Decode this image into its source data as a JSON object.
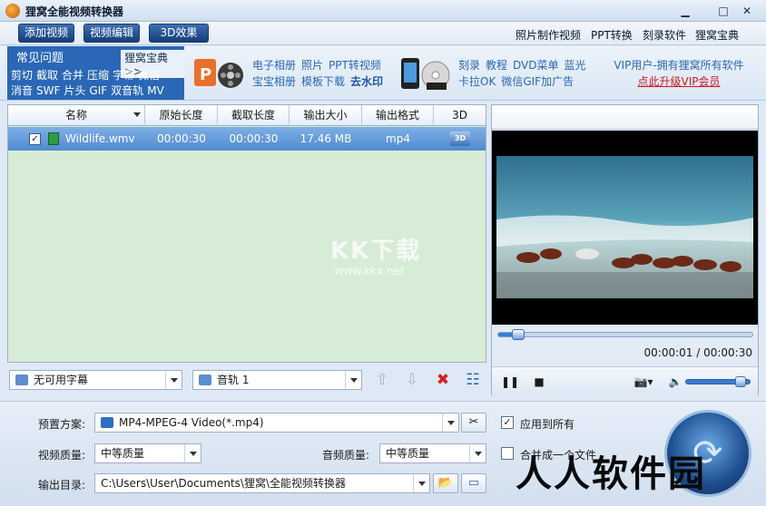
{
  "titlebar": {
    "title": "狸窝全能视频转换器",
    "minimize": "▁",
    "maximize": "□",
    "close": "✕"
  },
  "menubar": {
    "buttons": [
      "添加视频",
      "视频编辑",
      "3D效果"
    ],
    "links": [
      "照片制作视频",
      "PPT转换",
      "刻录软件",
      "狸窝宝典"
    ]
  },
  "banner": {
    "faq_title": "常见问题",
    "faq_more": "狸窝宝典>>",
    "faq_row1": [
      "剪切",
      "截取",
      "合并",
      "压缩",
      "字幕",
      "微信"
    ],
    "faq_row2": [
      "消音",
      "SWF",
      "片头",
      "GIF",
      "双音轨",
      "MV"
    ],
    "mid_row1": [
      "电子相册",
      "照片",
      "PPT转视频"
    ],
    "mid_row2": [
      "宝宝相册",
      "模板下载"
    ],
    "mid_bold": "去水印",
    "right_row1": [
      "刻录",
      "教程",
      "DVD菜单",
      "蓝光"
    ],
    "right_row2": [
      "卡拉OK",
      "微信GIF加广告"
    ],
    "vip_text": "VIP用户-拥有狸窝所有软件",
    "vip_upgrade": "点此升级VIP会员"
  },
  "file_list": {
    "columns": [
      "名称",
      "原始长度",
      "截取长度",
      "输出大小",
      "输出格式",
      "3D"
    ],
    "rows": [
      {
        "name": "Wildlife.wmv",
        "original_length": "00:00:30",
        "clip_length": "00:00:30",
        "output_size": "17.46 MB",
        "output_format": "mp4",
        "checked": "✓"
      }
    ],
    "watermark": "KK下载",
    "watermark_url": "www.kkx.net"
  },
  "subtitle_select": "无可用字幕",
  "audio_select": "音轨 1",
  "list_tools": {
    "up": "⇧",
    "down": "⇩",
    "delete": "✖",
    "clear": "☷"
  },
  "preview": {
    "timecode": "00:00:01 / 00:00:30",
    "progress": 0.033,
    "volume": 0.85,
    "pause_icon": "❚❚",
    "stop_icon": "■",
    "camera_icon": "📷▾",
    "volume_icon": "🔈"
  },
  "settings": {
    "preset_label": "预置方案:",
    "preset_value": "MP4-MPEG-4 Video(*.mp4)",
    "video_quality_label": "视频质量:",
    "video_quality_value": "中等质量",
    "audio_quality_label": "音频质量:",
    "audio_quality_value": "中等质量",
    "output_dir_label": "输出目录:",
    "output_dir_value": "C:\\Users\\User\\Documents\\狸窝\\全能视频转换器",
    "apply_all": "应用到所有",
    "apply_all_checked": "✓",
    "merge": "合并成一个文件",
    "tools_icon": "✂",
    "folder_icon": "📂",
    "open_icon": "▭"
  },
  "bottom_watermark": "人人软件园",
  "colors": {
    "accent": "#2a67b6",
    "list_bg": "#d6ecd6",
    "selected_row": "#4f8ad1",
    "vip_red": "#d01818"
  }
}
